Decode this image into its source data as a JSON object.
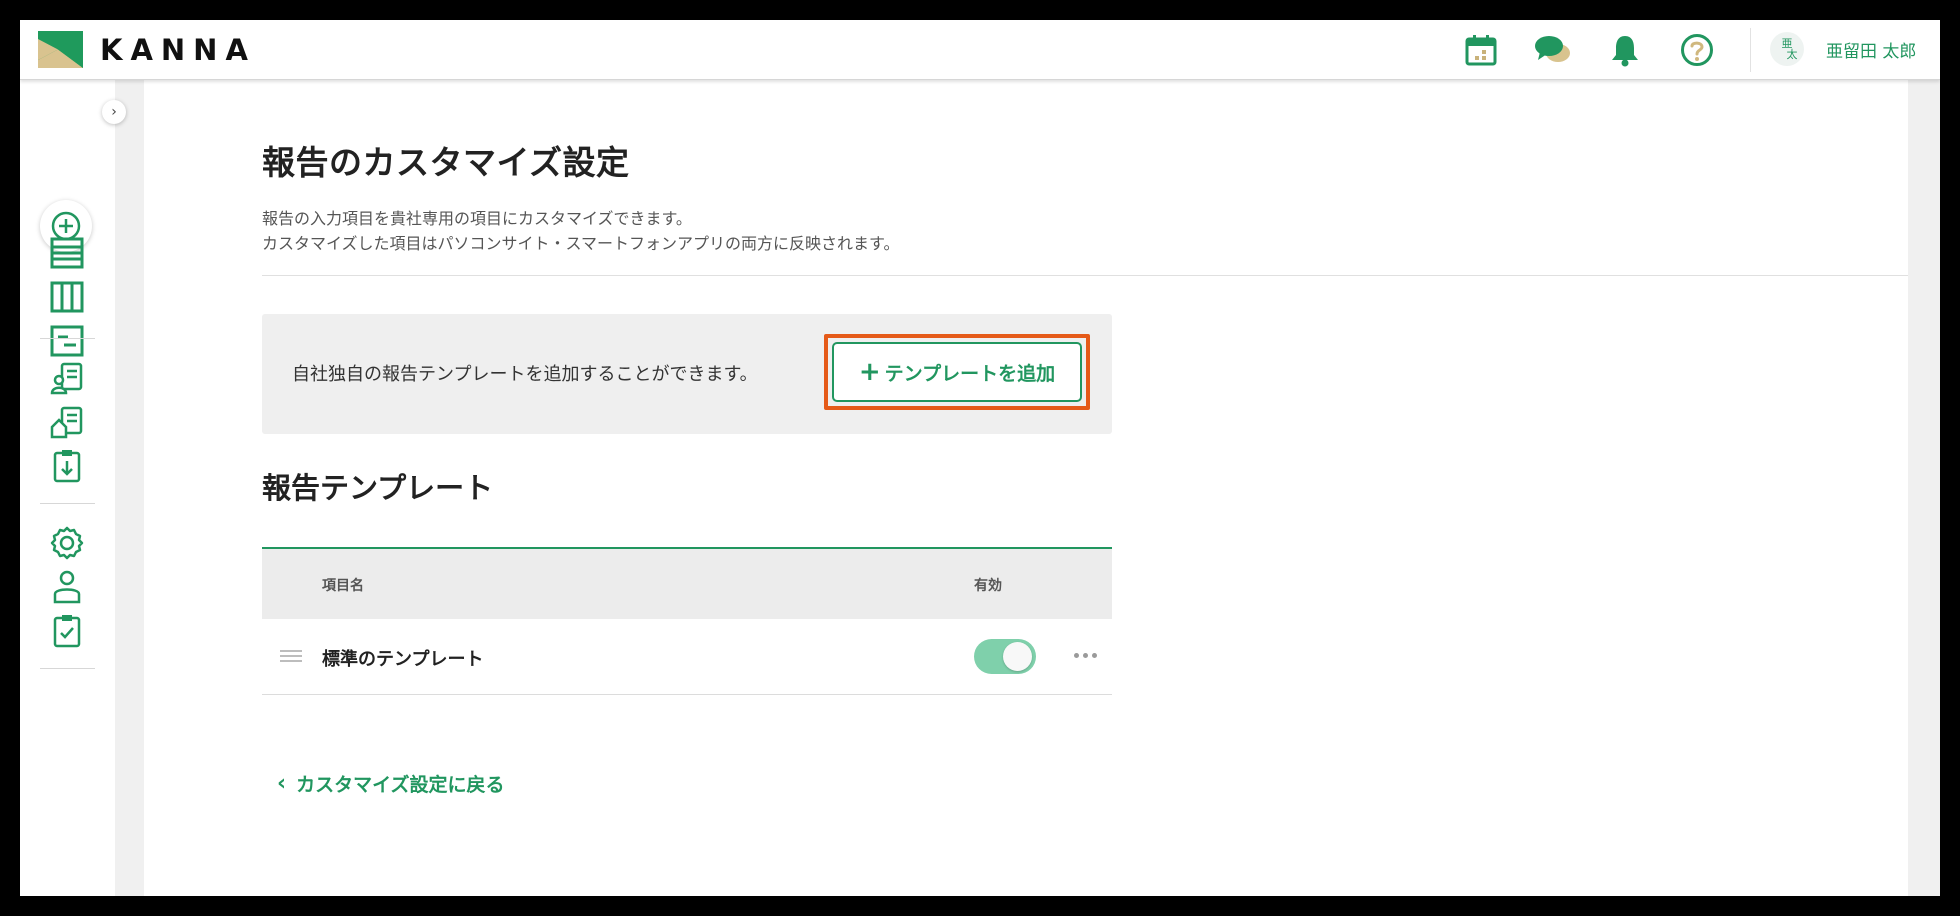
{
  "app": {
    "logo_text": "KANNA"
  },
  "header": {
    "user_avatar_text_top": "亜",
    "user_avatar_text_bottom": "太",
    "user_name": "亜留田 太郎",
    "icons": [
      "calendar-icon",
      "chat-icon",
      "bell-icon",
      "help-icon"
    ]
  },
  "colors": {
    "brand": "#21965f",
    "highlight": "#e55a18",
    "toggle_on": "#7fd0ab"
  },
  "page": {
    "title": "報告のカスタマイズ設定",
    "description_line1": "報告の入力項目を貴社専用の項目にカスタマイズできます。",
    "description_line2": "カスタマイズした項目はパソコンサイト・スマートフォンアプリの両方に反映されます。"
  },
  "info": {
    "text": "自社独自の報告テンプレートを追加することができます。",
    "add_button_label": "テンプレートを追加"
  },
  "templates": {
    "section_title": "報告テンプレート",
    "col_name": "項目名",
    "col_active": "有効",
    "rows": [
      {
        "name": "標準のテンプレート",
        "active": true
      }
    ]
  },
  "back_link": "カスタマイズ設定に戻る"
}
